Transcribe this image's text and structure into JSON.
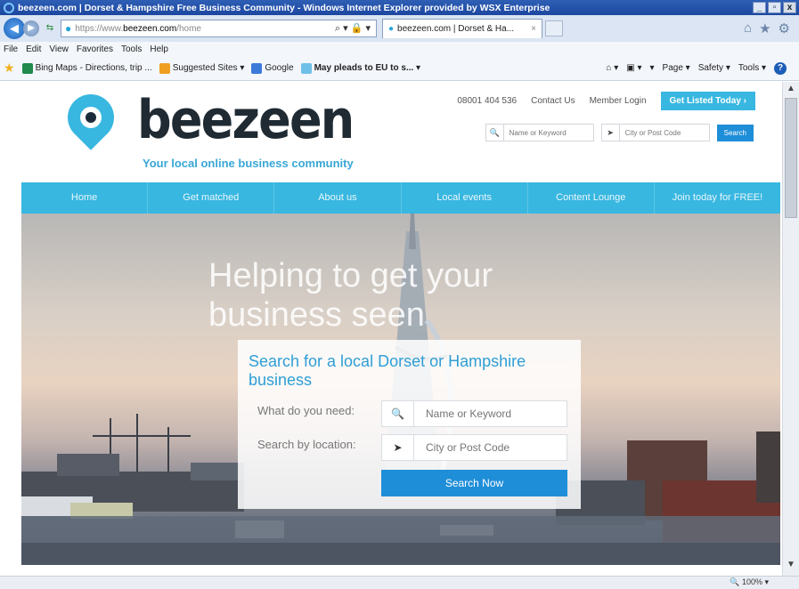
{
  "window": {
    "title": "beezeen.com | Dorset & Hampshire Free Business Community - Windows Internet Explorer provided by WSX Enterprise",
    "buttons": [
      "_",
      "▫",
      "x"
    ]
  },
  "address_bar": {
    "url_scheme": "https://www.",
    "url_host": "beezeen.com",
    "url_path": "/home",
    "tab_title": "beezeen.com | Dorset & Ha...",
    "tab_close": "×"
  },
  "menu": [
    "File",
    "Edit",
    "View",
    "Favorites",
    "Tools",
    "Help"
  ],
  "favorites": [
    {
      "label": "Bing Maps - Directions, trip ...",
      "color": "#1f8a4c",
      "bold": false
    },
    {
      "label": "Suggested Sites ▾",
      "color": "#f0a020",
      "bold": false
    },
    {
      "label": "Google",
      "color": "#3b7ad8",
      "bold": false
    },
    {
      "label": "May pleads to EU to s... ▾",
      "color": "#6fc0e8",
      "bold": true
    }
  ],
  "command_bar": [
    "▾",
    "Page ▾",
    "Safety ▾",
    "Tools ▾"
  ],
  "header": {
    "phone": "08001 404 536",
    "contact": "Contact Us",
    "login": "Member Login",
    "cta": "Get Listed Today  ›",
    "logo_word": "beezeen",
    "tagline": "Your local online business community",
    "search_keyword_placeholder": "Name or Keyword",
    "search_location_placeholder": "City or Post Code",
    "search_button": "Search"
  },
  "nav": [
    "Home",
    "Get matched",
    "About us",
    "Local events",
    "Content Lounge",
    "Join today for FREE!"
  ],
  "hero": {
    "heading_line1": "Helping to get your",
    "heading_line2": "business seen",
    "panel_title": "Search for a local Dorset or Hampshire business",
    "need_label": "What do you need:",
    "location_label": "Search by location:",
    "keyword_placeholder": "Name or Keyword",
    "location_placeholder": "City or Post Code",
    "search_button": "Search Now"
  },
  "status": {
    "zoom": "100%"
  },
  "colors": {
    "brand_blue": "#38b7e0",
    "button_blue": "#1f8ed8",
    "logo_dark": "#1f2a33"
  }
}
